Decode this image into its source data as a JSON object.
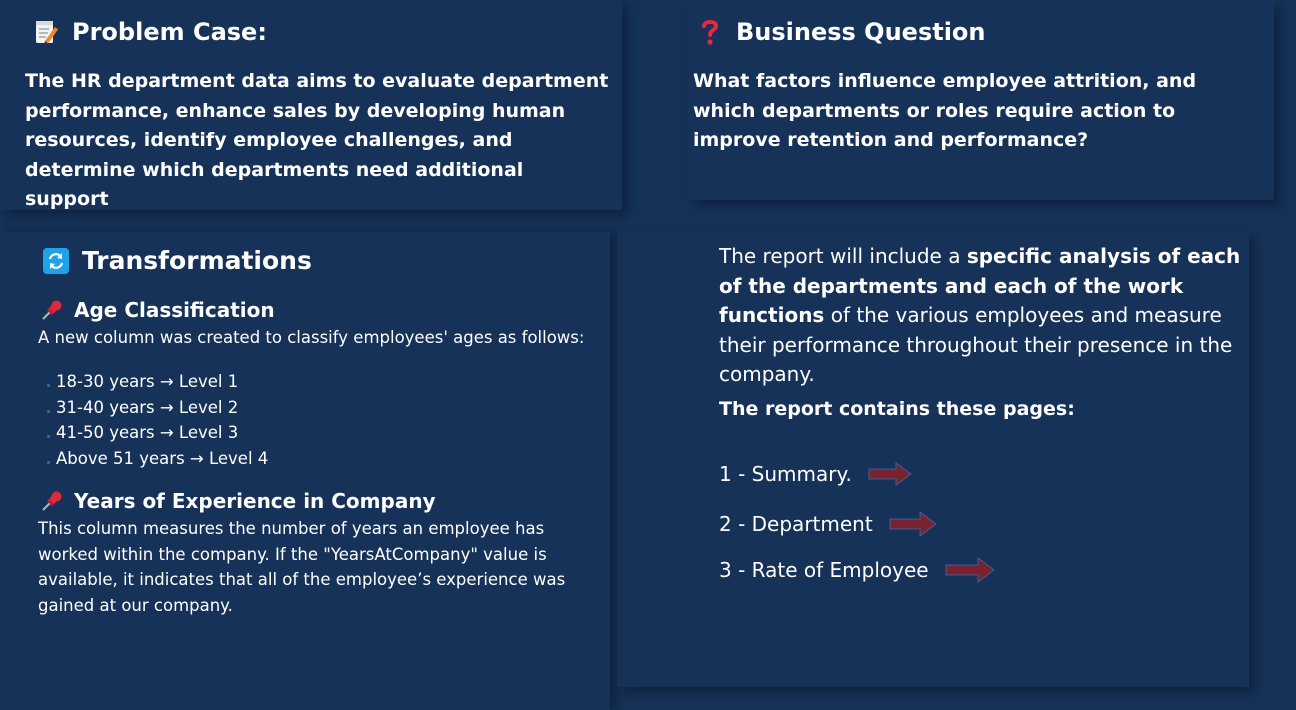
{
  "problem": {
    "title": "Problem Case:",
    "icon": "memo-icon",
    "text": "The HR department data aims to evaluate department performance, enhance sales by developing human resources, identify employee challenges, and determine which departments need additional support"
  },
  "business": {
    "title": "Business Question",
    "icon": "question-mark-icon",
    "text": "What factors influence employee attrition, and which departments or roles require action to improve retention and performance?"
  },
  "transformations": {
    "title": "Transformations",
    "icon": "refresh-icon",
    "age": {
      "heading": "Age Classification",
      "intro": "A new column was created to classify employees' ages as follows:",
      "levels": [
        "18-30 years → Level 1",
        "31-40 years → Level 2",
        "41-50 years → Level 3",
        "Above 51 years → Level 4"
      ]
    },
    "experience": {
      "heading": "Years of Experience in Company",
      "text": "This column measures the number of years an employee has worked within the company. If the \"YearsAtCompany\" value is available, it indicates that all of the employee’s experience was gained at our company."
    }
  },
  "report": {
    "intro_1": "The report will include a ",
    "intro_bold": "specific analysis of each of the departments and each of the work functions",
    "intro_2": " of the various employees and measure their performance throughout their presence in the company.",
    "pages_heading": "The report contains these pages:",
    "pages": [
      "1 - Summary.",
      "2 - Department",
      "3 - Rate of Employee"
    ]
  },
  "colors": {
    "background": "#163258",
    "arrow": "#7a2330",
    "pin": "#e0293d",
    "refresh": "#1fa3e8",
    "question": "#e8283f"
  }
}
